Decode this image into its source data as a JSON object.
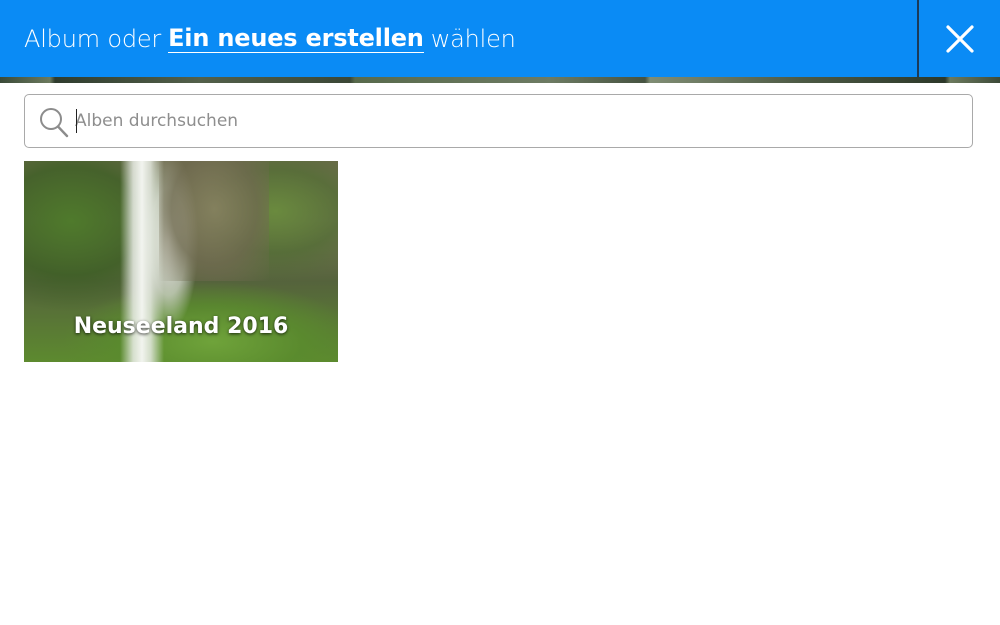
{
  "header": {
    "title_prefix": "Album oder",
    "title_link": "Ein neues erstellen",
    "title_suffix": "wählen",
    "accent_color": "#0a8bf5",
    "close_icon": "close-icon"
  },
  "search": {
    "placeholder": "Alben durchsuchen",
    "value": "",
    "icon": "search-icon"
  },
  "albums": [
    {
      "label": "Neuseeland 2016"
    }
  ]
}
